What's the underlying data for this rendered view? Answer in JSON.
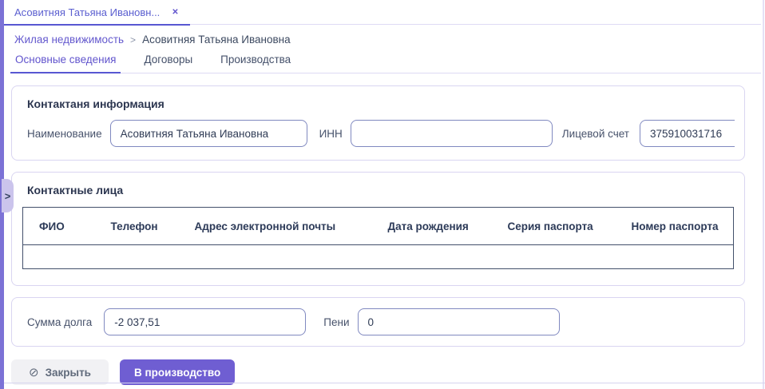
{
  "window_tab": {
    "title": "Асовитняя Татьяна Ивановн...",
    "close_icon": "✕"
  },
  "breadcrumb": {
    "link": "Жилая недвижимость",
    "separator": ">",
    "current": "Асовитняя Татьяна Ивановна"
  },
  "tabs": [
    {
      "label": "Основные сведения",
      "active": true
    },
    {
      "label": "Договоры",
      "active": false
    },
    {
      "label": "Производства",
      "active": false
    }
  ],
  "contact_info": {
    "title": "Контактаня информация",
    "fields": [
      {
        "label": "Наименование",
        "value": "Асовитняя Татьяна Ивановна"
      },
      {
        "label": "ИНН",
        "value": ""
      },
      {
        "label": "Лицевой счет",
        "value": "375910031716"
      }
    ]
  },
  "contact_persons": {
    "title": "Контактные лица",
    "columns": [
      "ФИО",
      "Телефон",
      "Адрес электронной почты",
      "Дата рождения",
      "Серия паспорта",
      "Номер паспорта"
    ]
  },
  "debt": {
    "fields": [
      {
        "label": "Сумма долга",
        "value": "-2 037,51"
      },
      {
        "label": "Пени",
        "value": "0"
      }
    ]
  },
  "actions": {
    "close_label": "Закрыть",
    "close_icon": "⊘",
    "production_label": "В производство"
  },
  "side_toggle_icon": ">",
  "colors": {
    "accent_purple": "#6f5ed2",
    "link_purple": "#6459ce",
    "tab_underline": "#5857d2",
    "left_bar": "#7c72d6",
    "input_border": "#8089c0",
    "card_border": "#d9d5f1",
    "table_border": "#43506b",
    "dark_text": "#2c3650"
  }
}
